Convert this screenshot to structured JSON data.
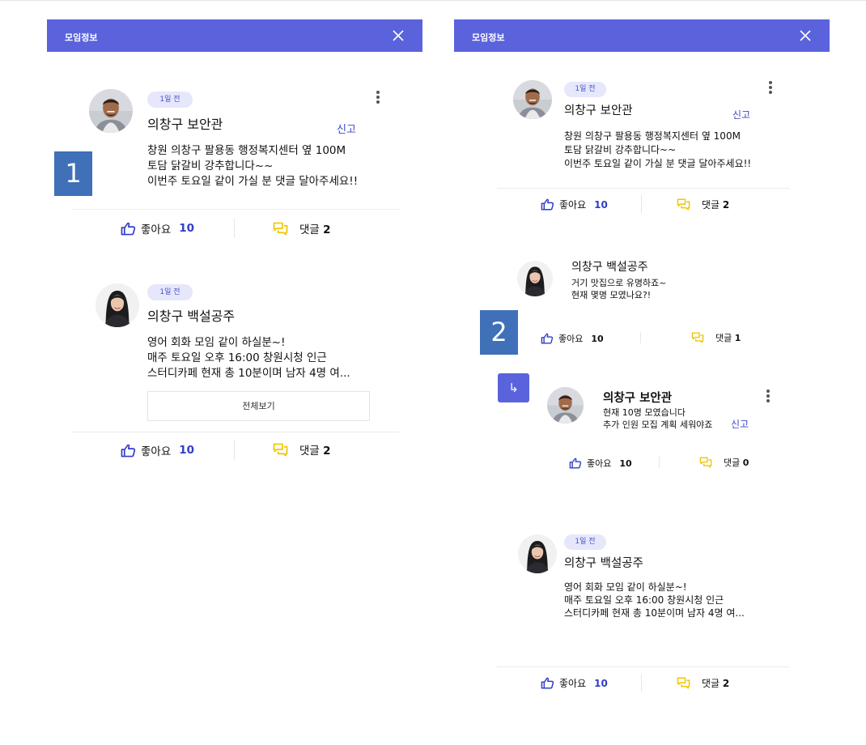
{
  "panel_left": {
    "header": {
      "title": "모임정보"
    },
    "annotation": "1",
    "posts": [
      {
        "badge": "1일 전",
        "author": "의창구 보안관",
        "report": "신고",
        "text": "창원 의창구 팔용동 행정복지센터 옆 100M\n토담 닭갈비 강추합니다~~\n이번주 토요일 같이 가실 분 댓글 달아주세요!!",
        "like_label": "좋아요",
        "like_count": "10",
        "comment_label": "댓글",
        "comment_count": "2"
      },
      {
        "badge": "1일 전",
        "author": "의창구 백설공주",
        "text": "영어 회화 모임 같이 하실분~!\n매주 토요일 오후 16:00 창원시청 인근\n스터디카페 현재 총 10분이며 남자 4명 여...",
        "see_all": "전체보기",
        "like_label": "좋아요",
        "like_count": "10",
        "comment_label": "댓글",
        "comment_count": "2"
      }
    ]
  },
  "panel_right": {
    "header": {
      "title": "모임정보"
    },
    "annotation": "2",
    "reply_icon": "↳",
    "post": {
      "badge": "1일 전",
      "author": "의창구 보안관",
      "report": "신고",
      "text": "창원 의창구 팔용동 행정복지센터 옆 100M\n토담 닭갈비 강추합니다~~\n이번주 토요일 같이 가실 분 댓글 달아주세요!!",
      "like_label": "좋아요",
      "like_count": "10",
      "comment_label": "댓글",
      "comment_count": "2"
    },
    "comment": {
      "author": "의창구 백설공주",
      "text": "거기 맛집으로 유명하죠~\n현재 몇명 모였나요?!",
      "like_label": "좋아요",
      "like_count": "10",
      "comment_label": "댓글",
      "comment_count": "1"
    },
    "reply": {
      "author": "의창구 보안관",
      "text": "현재 10명 모였습니다\n추가 인원 모집 계획 세워야죠",
      "report": "신고",
      "like_label": "좋아요",
      "like_count": "10",
      "comment_label": "댓글",
      "comment_count": "0"
    },
    "post2": {
      "badge": "1일 전",
      "author": "의창구 백설공주",
      "text": "영어 회화 모임 같이 하실분~!\n매주 토요일 오후 16:00 창원시청 인근\n스터디카페 현재 총 10분이며 남자 4명 여...",
      "like_label": "좋아요",
      "like_count": "10",
      "comment_label": "댓글",
      "comment_count": "2"
    }
  },
  "colors": {
    "header": "#5a63dc",
    "accent_blue": "#2f3fc7",
    "comment_icon": "#f2c500",
    "marker": "#3f70b8"
  },
  "icons": {
    "close": "close-icon",
    "more": "more-vertical-icon",
    "like": "thumbs-up-icon",
    "comment": "comment-bubble-icon",
    "reply": "reply-arrow-icon"
  }
}
